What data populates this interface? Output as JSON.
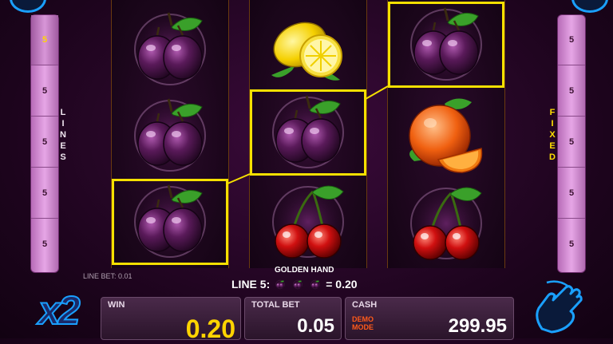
{
  "left_panel": {
    "label": "LINES",
    "values": [
      "5",
      "5",
      "5",
      "5",
      "5"
    ],
    "active_index": 0
  },
  "right_panel": {
    "label": "FIXED",
    "values": [
      "5",
      "5",
      "5",
      "5",
      "5"
    ]
  },
  "reels": [
    [
      "plum",
      "plum",
      "plum"
    ],
    [
      "lemon",
      "plum",
      "cherry"
    ],
    [
      "plum",
      "orange",
      "cherry"
    ]
  ],
  "win_line_highlight": [
    "reel1-row3",
    "reel2-row2",
    "reel3-row1"
  ],
  "line_bet_text": "LINE BET: 0.01",
  "golden_hand_label": "GOLDEN HAND",
  "line_win": {
    "prefix": "LINE 5:",
    "suffix": "= 0.20",
    "symbol": "plum",
    "count": 3
  },
  "multiplier": "x2",
  "win": {
    "label": "WIN",
    "value": "0.20"
  },
  "total_bet": {
    "label": "TOTAL BET",
    "value": "0.05"
  },
  "cash": {
    "label": "CASH",
    "value": "299.95",
    "mode_line1": "DEMO",
    "mode_line2": "MODE"
  },
  "colors": {
    "highlight": "#f5e000",
    "win_value": "#ffd400",
    "accent_blue": "#1aa0ff"
  }
}
